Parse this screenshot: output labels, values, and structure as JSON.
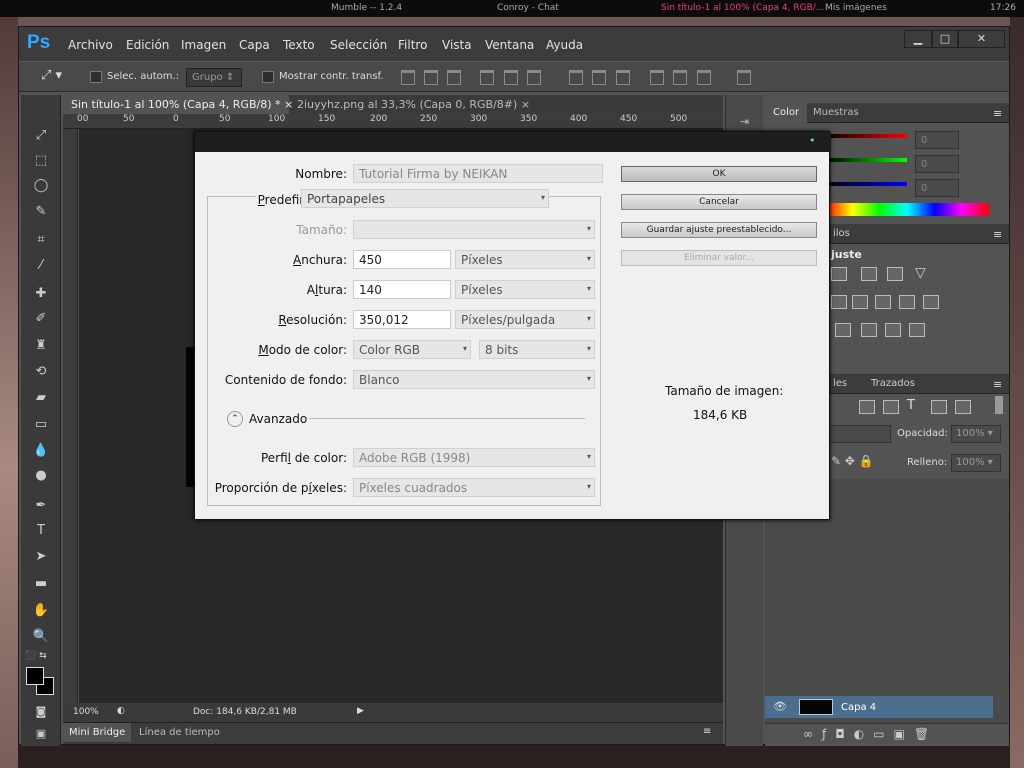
{
  "taskbar": {
    "item1": "Mumble -- 1.2.4",
    "item2": "Conroy - Chat",
    "item3": "Sin título-1 al 100% (Capa 4, RGB/...",
    "item4": "Mis imágenes",
    "clock": "17:26"
  },
  "app": {
    "logo": "Ps",
    "menu": [
      "Archivo",
      "Edición",
      "Imagen",
      "Capa",
      "Texto",
      "Selección",
      "Filtro",
      "Vista",
      "Ventana",
      "Ayuda"
    ]
  },
  "options": {
    "auto_select": "Selec. autom.:",
    "group": "Grupo",
    "show_transform": "Mostrar contr. transf."
  },
  "tabs": [
    {
      "label": "Sin título-1 al 100% (Capa 4, RGB/8) *"
    },
    {
      "label": "2iuyyhz.png al 33,3% (Capa 0, RGB/8#)"
    }
  ],
  "ruler": {
    "marks": [
      "00",
      "50",
      "0",
      "50",
      "100",
      "150",
      "200",
      "250",
      "300",
      "350",
      "400",
      "450",
      "500"
    ]
  },
  "status": {
    "zoom": "100%",
    "doc": "Doc: 184,6 KB/2,81 MB"
  },
  "bottom_tabs": {
    "bridge": "Mini Bridge",
    "timeline": "Línea de tiempo"
  },
  "panels": {
    "color_tab": "Color",
    "swatches_tab": "Muestras",
    "slider_values": [
      "0",
      "0",
      "0"
    ],
    "styles_fragment": "ilos",
    "adjust_fragment": "juste",
    "layers_fragment": "les",
    "paths_tab": "Trazados",
    "opacity_label": "Opacidad:",
    "opacity_value": "100%",
    "fill_label": "Relleno:",
    "fill_value": "100%",
    "layer_name": "Capa 4"
  },
  "dialog": {
    "name_label": "Nombre:",
    "name_value": "Tutorial Firma by NEIKAN",
    "preset_label": "Predefinir:",
    "preset_value": "Portapapeles",
    "size_label": "Tamaño:",
    "width_label": "Anchura:",
    "width_value": "450",
    "width_unit": "Píxeles",
    "height_label": "Altura:",
    "height_value": "140",
    "height_unit": "Píxeles",
    "res_label": "Resolución:",
    "res_value": "350,012",
    "res_unit": "Píxeles/pulgada",
    "mode_label": "Modo de color:",
    "mode_value": "Color RGB",
    "bits_value": "8 bits",
    "bg_label": "Contenido de fondo:",
    "bg_value": "Blanco",
    "advanced": "Avanzado",
    "profile_label": "Perfil de color:",
    "profile_value": "Adobe RGB (1998)",
    "aspect_label": "Proporción de píxeles:",
    "aspect_value": "Píxeles cuadrados",
    "ok": "OK",
    "cancel": "Cancelar",
    "save_preset": "Guardar ajuste preestablecido...",
    "delete_preset": "Eliminar valor...",
    "image_size_label": "Tamaño de imagen:",
    "image_size_value": "184,6 KB"
  }
}
